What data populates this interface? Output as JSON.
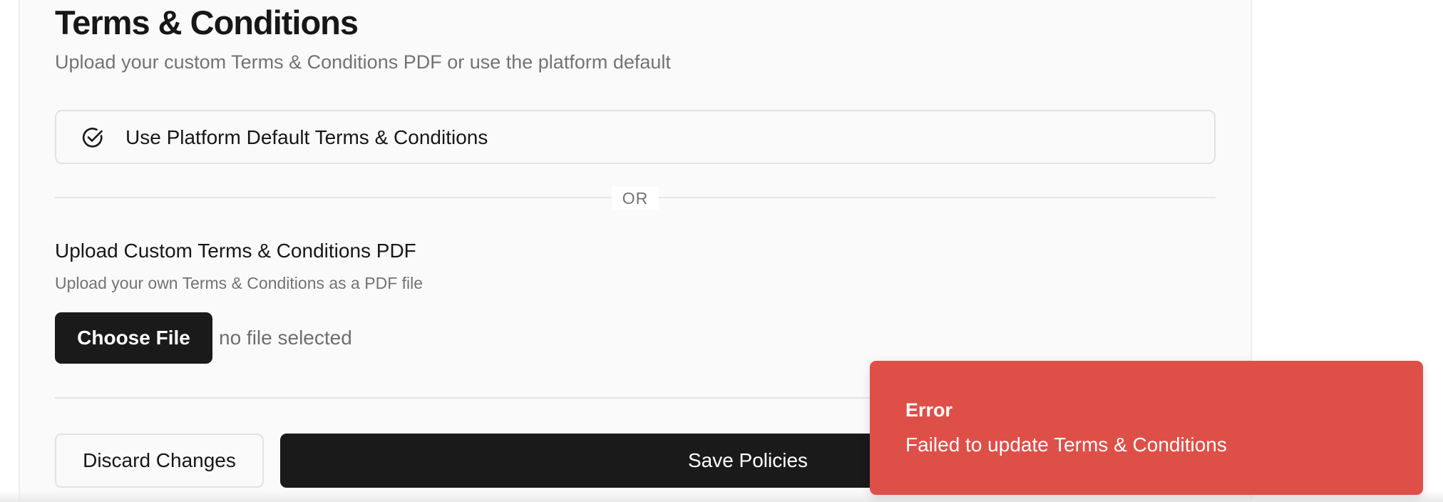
{
  "header": {
    "title": "Terms & Conditions",
    "subtitle": "Upload your custom Terms & Conditions PDF or use the platform default"
  },
  "default_option": {
    "label": "Use Platform Default Terms & Conditions",
    "icon": "check-circle-icon"
  },
  "divider": {
    "label": "OR"
  },
  "upload": {
    "title": "Upload Custom Terms & Conditions PDF",
    "description": "Upload your own Terms & Conditions as a PDF file",
    "choose_label": "Choose File",
    "file_status": "no file selected"
  },
  "actions": {
    "discard_label": "Discard Changes",
    "save_label": "Save Policies"
  },
  "toast": {
    "title": "Error",
    "message": "Failed to update Terms & Conditions",
    "color": "#de4f48"
  },
  "colors": {
    "primary_button": "#1a1a1a",
    "background": "#fafafa",
    "border": "#e2e2e2",
    "muted_text": "#737373"
  }
}
